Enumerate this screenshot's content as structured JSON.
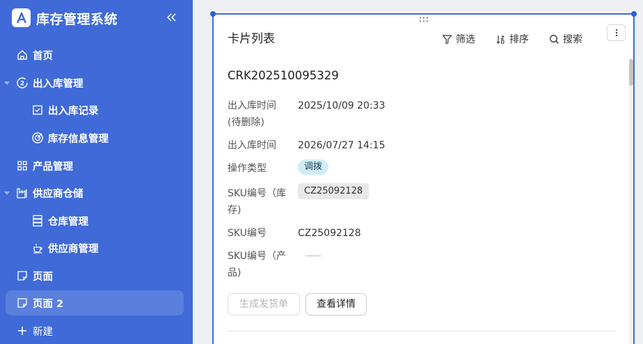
{
  "app": {
    "title": "库存管理系统"
  },
  "sidebar": {
    "items": [
      {
        "label": "首页"
      },
      {
        "label": "出入库管理"
      },
      {
        "label": "出入库记录"
      },
      {
        "label": "库存信息管理"
      },
      {
        "label": "产品管理"
      },
      {
        "label": "供应商仓储"
      },
      {
        "label": "仓库管理"
      },
      {
        "label": "供应商管理"
      },
      {
        "label": "页面"
      },
      {
        "label": "页面 2"
      },
      {
        "label": "新建"
      }
    ],
    "active_item": "页面 2"
  },
  "card": {
    "title": "卡片列表",
    "toolbar": {
      "filter": "筛选",
      "sort": "排序",
      "search": "搜索"
    },
    "record": {
      "id": "CRK202510095329",
      "fields": [
        {
          "label": "出入库时间\n(待删除)",
          "value": "2025/10/09 20:33"
        },
        {
          "label": "出入库时间",
          "value": "2026/07/27 14:15"
        },
        {
          "label": "操作类型",
          "value": "调拨"
        },
        {
          "label": "SKU编号（库存)",
          "value": "CZ25092128"
        },
        {
          "label": "SKU编号",
          "value": "CZ25092128"
        },
        {
          "label": "SKU编号（产品)",
          "value": ""
        }
      ],
      "buttons": {
        "generate": "生成发货单",
        "view": "查看详情"
      }
    }
  },
  "colors": {
    "sidebar": "#3f6ad8",
    "accent": "#3a6ee0",
    "tag_blue": "#cfeef6"
  }
}
